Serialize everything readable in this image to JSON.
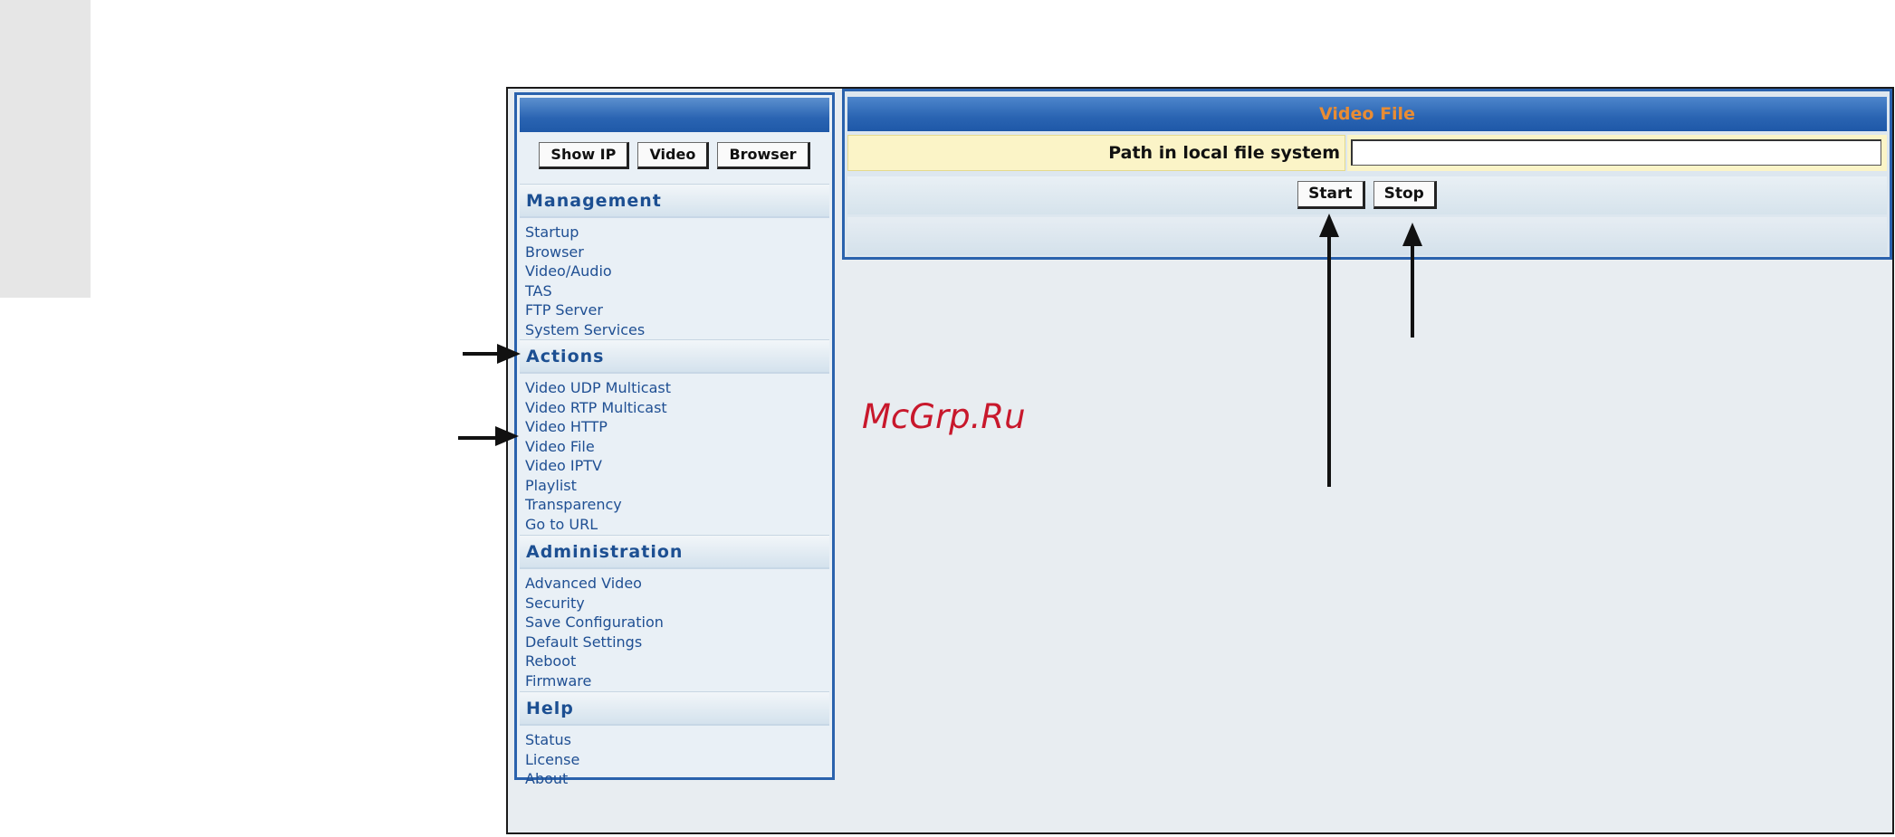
{
  "sidebar": {
    "top_buttons": [
      "Show IP",
      "Video",
      "Browser"
    ],
    "sections": [
      {
        "title": "Management",
        "items": [
          "Startup",
          "Browser",
          "Video/Audio",
          "TAS",
          "FTP Server",
          "System Services"
        ]
      },
      {
        "title": "Actions",
        "items": [
          "Video UDP Multicast",
          "Video RTP Multicast",
          "Video HTTP",
          "Video File",
          "Video IPTV",
          "Playlist",
          "Transparency",
          "Go to URL"
        ]
      },
      {
        "title": "Administration",
        "items": [
          "Advanced Video",
          "Security",
          "Save Configuration",
          "Default Settings",
          "Reboot",
          "Firmware"
        ]
      },
      {
        "title": "Help",
        "items": [
          "Status",
          "License",
          "About"
        ]
      }
    ]
  },
  "main": {
    "title": "Video File",
    "path_label": "Path in local file system",
    "path_value": "",
    "start_label": "Start",
    "stop_label": "Stop"
  },
  "watermark": "McGrp.Ru",
  "colors": {
    "header_blue": "#2a64b2",
    "title_orange": "#e98c33",
    "link_blue": "#1f4f93",
    "field_yellow": "#fbf4c7",
    "watermark_red": "#c8182c"
  }
}
